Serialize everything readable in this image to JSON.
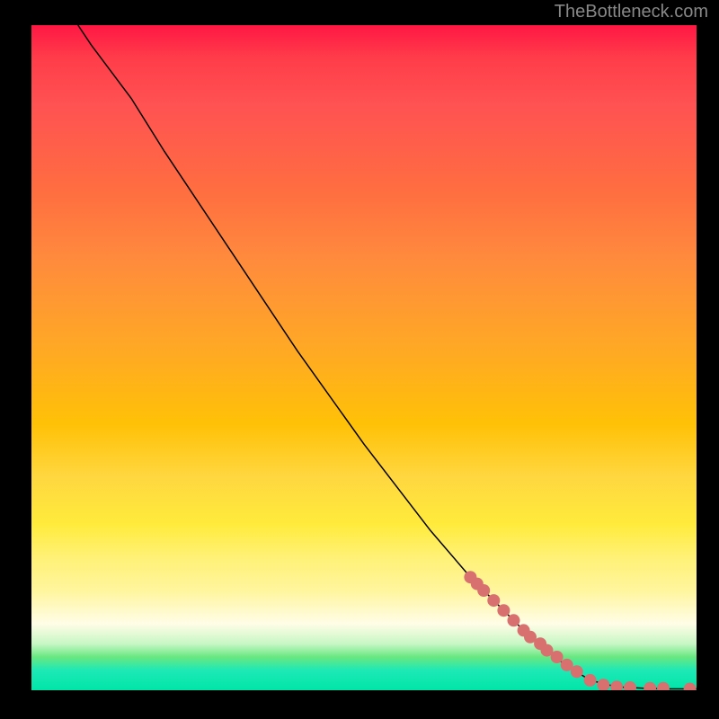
{
  "attribution": "TheBottleneck.com",
  "chart_data": {
    "type": "line",
    "title": "",
    "xlabel": "",
    "ylabel": "",
    "xlim": [
      0,
      100
    ],
    "ylim": [
      0,
      100
    ],
    "curve": {
      "name": "main-curve",
      "color": "#000000",
      "points": [
        {
          "x": 7,
          "y": 100
        },
        {
          "x": 9,
          "y": 97
        },
        {
          "x": 12,
          "y": 93
        },
        {
          "x": 15,
          "y": 89
        },
        {
          "x": 20,
          "y": 81
        },
        {
          "x": 30,
          "y": 66
        },
        {
          "x": 40,
          "y": 51
        },
        {
          "x": 50,
          "y": 37
        },
        {
          "x": 60,
          "y": 24
        },
        {
          "x": 66,
          "y": 17
        },
        {
          "x": 70,
          "y": 13
        },
        {
          "x": 75,
          "y": 8
        },
        {
          "x": 80,
          "y": 4
        },
        {
          "x": 84,
          "y": 1.5
        },
        {
          "x": 88,
          "y": 0.5
        },
        {
          "x": 92,
          "y": 0.3
        },
        {
          "x": 96,
          "y": 0.2
        },
        {
          "x": 100,
          "y": 0.2
        }
      ]
    },
    "markers": {
      "name": "highlighted-points",
      "color": "#d87070",
      "points": [
        {
          "x": 66,
          "y": 17
        },
        {
          "x": 67,
          "y": 16
        },
        {
          "x": 68,
          "y": 15
        },
        {
          "x": 69.5,
          "y": 13.5
        },
        {
          "x": 71,
          "y": 12
        },
        {
          "x": 72.5,
          "y": 10.5
        },
        {
          "x": 74,
          "y": 9
        },
        {
          "x": 75,
          "y": 8
        },
        {
          "x": 76.5,
          "y": 7
        },
        {
          "x": 77.5,
          "y": 6
        },
        {
          "x": 79,
          "y": 5
        },
        {
          "x": 80.5,
          "y": 3.8
        },
        {
          "x": 82,
          "y": 2.8
        },
        {
          "x": 84,
          "y": 1.5
        },
        {
          "x": 86,
          "y": 0.8
        },
        {
          "x": 88,
          "y": 0.5
        },
        {
          "x": 90,
          "y": 0.4
        },
        {
          "x": 93,
          "y": 0.3
        },
        {
          "x": 95,
          "y": 0.3
        },
        {
          "x": 99,
          "y": 0.2
        }
      ]
    },
    "gradient_colors": {
      "top": "#ff1744",
      "middle": "#ffeb3b",
      "bottom": "#00e5a8"
    }
  }
}
